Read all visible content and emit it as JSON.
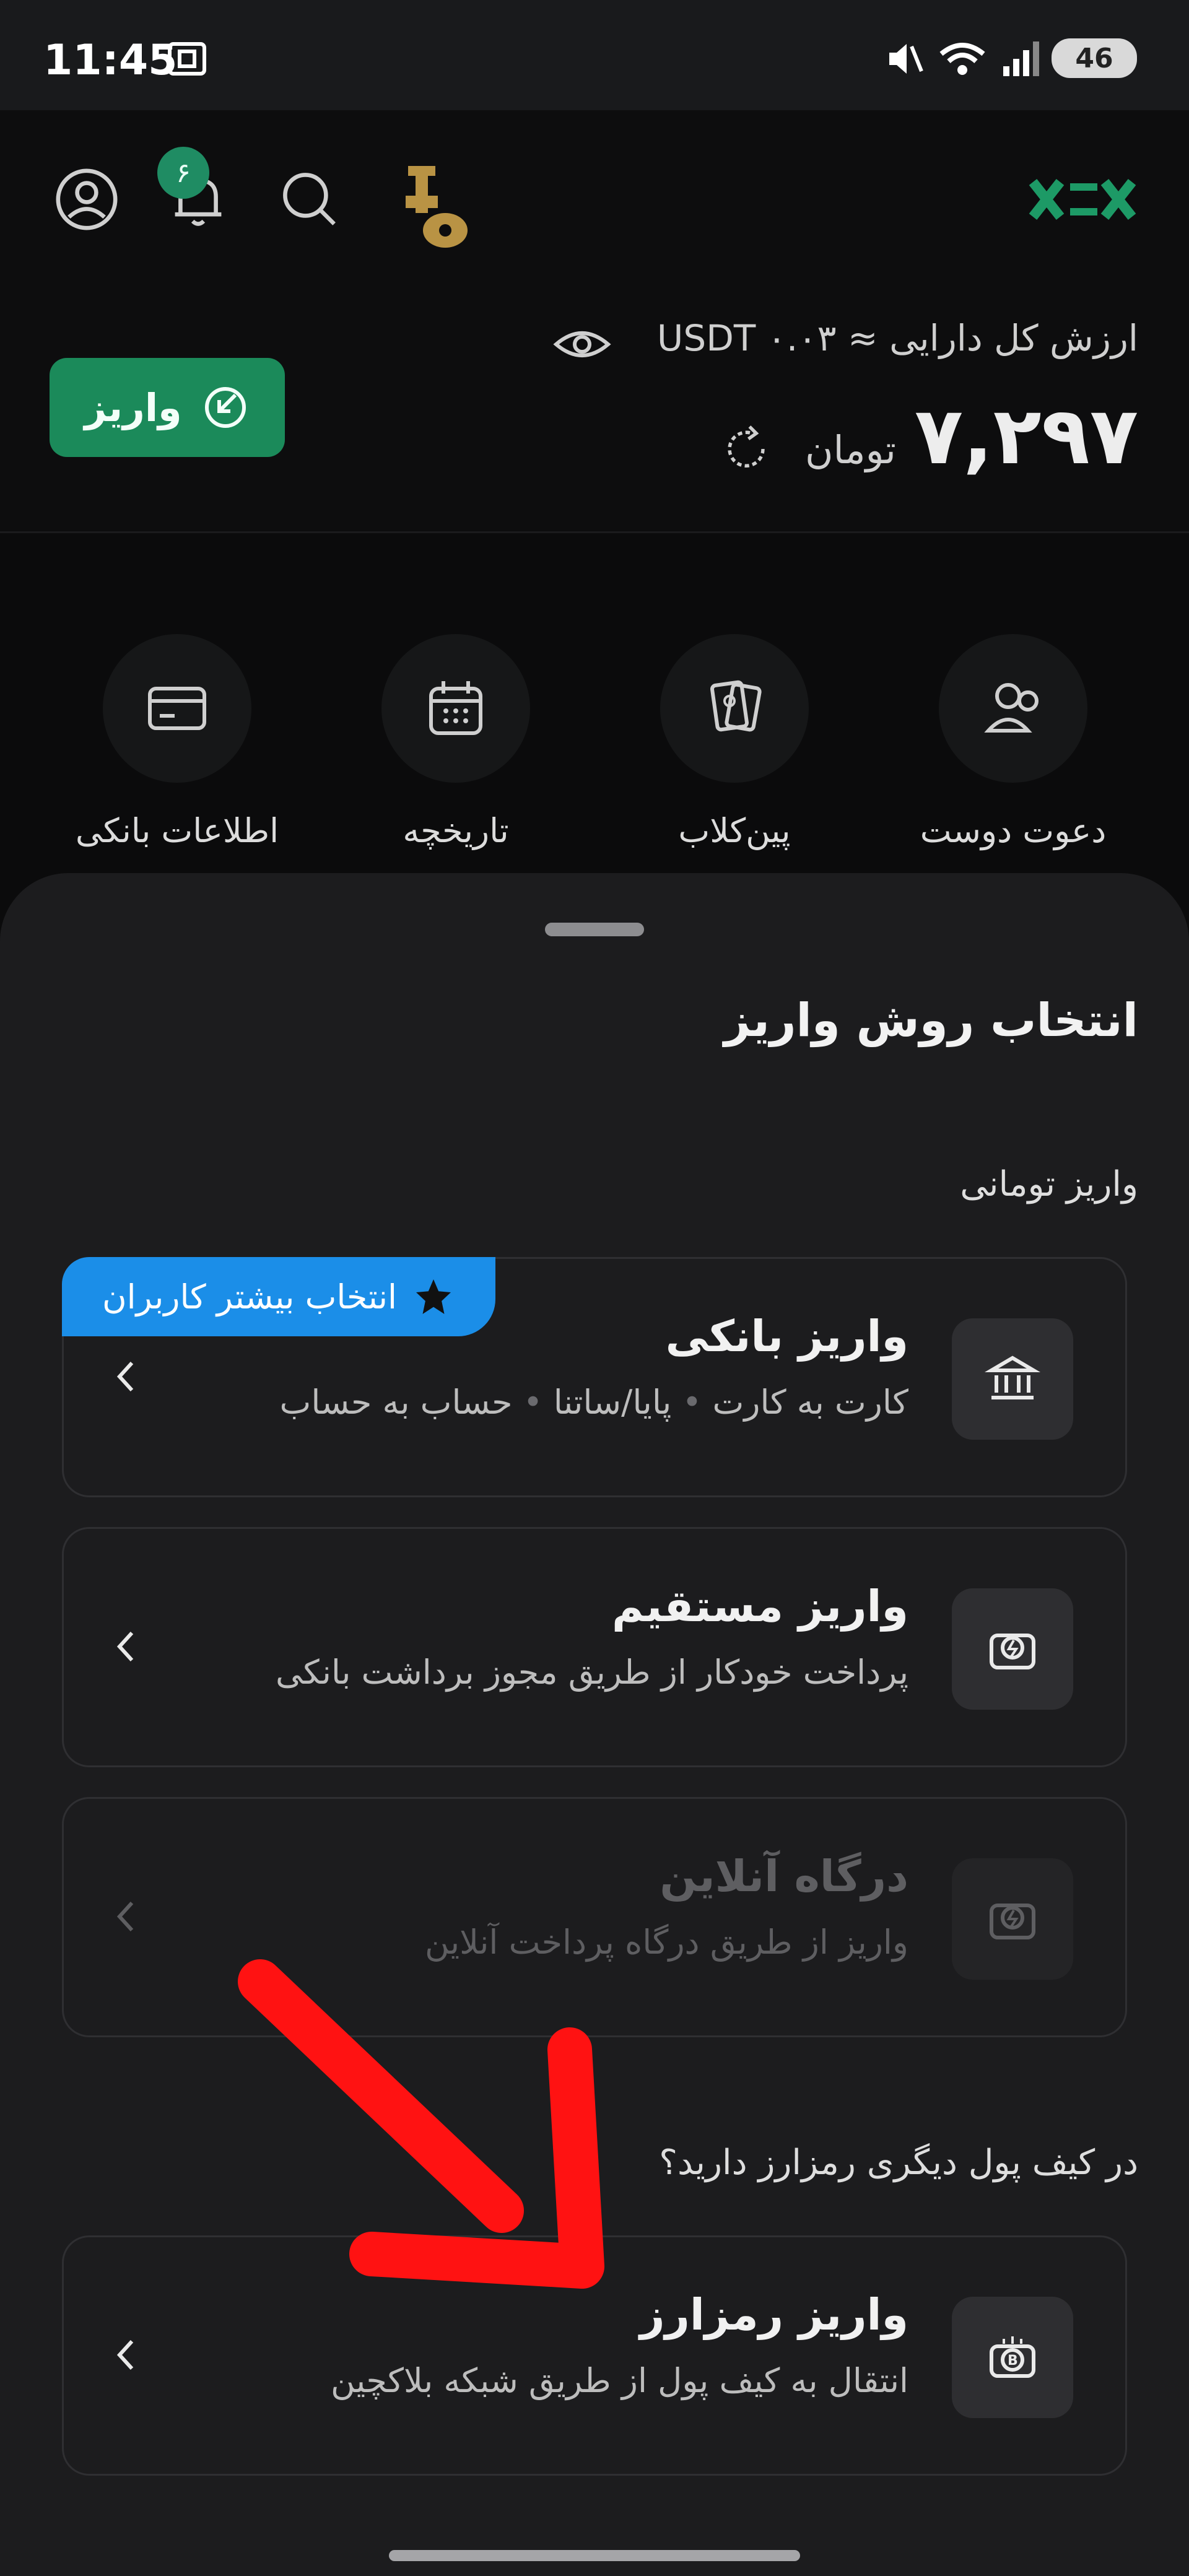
{
  "status_bar": {
    "time": "11:45",
    "battery": "46"
  },
  "header": {
    "notification_count": "۶",
    "total_label": "ارزش کل دارایی  ≈ USDT ۰.۰۳",
    "balance": "۷,۲۹۷",
    "currency": "تومان",
    "deposit_button": "واریز"
  },
  "quick_actions": [
    {
      "label": "دعوت دوست",
      "icon": "users-icon"
    },
    {
      "label": "پین‌کلاب",
      "icon": "tickets-icon"
    },
    {
      "label": "تاریخچه",
      "icon": "calendar-icon"
    },
    {
      "label": "اطلاعات بانکی",
      "icon": "card-icon"
    }
  ],
  "sheet": {
    "title": "انتخاب روش واریز",
    "section_toman": "واریز تومانی",
    "badge": "انتخاب بیشتر کاربران",
    "cards": [
      {
        "title": "واریز بانکی",
        "desc_parts": [
          "کارت به کارت",
          "پایا/ساتنا",
          "حساب به حساب"
        ],
        "state": "enabled"
      },
      {
        "title": "واریز مستقیم",
        "desc": "پرداخت خودکار از طریق مجوز برداشت بانکی",
        "state": "enabled"
      },
      {
        "title": "درگاه آنلاین",
        "desc": "واریز از طریق درگاه پرداخت آنلاین",
        "state": "disabled"
      }
    ],
    "section_crypto": "در کیف پول دیگری رمزارز دارید؟",
    "crypto_card": {
      "title": "واریز رمزارز",
      "desc": "انتقال به کیف پول از طریق شبکه بلاکچین",
      "state": "enabled"
    }
  },
  "colors": {
    "accent_green": "#1b8a5a",
    "badge_blue": "#1b8ee8",
    "arrow_red": "#ff1212"
  }
}
